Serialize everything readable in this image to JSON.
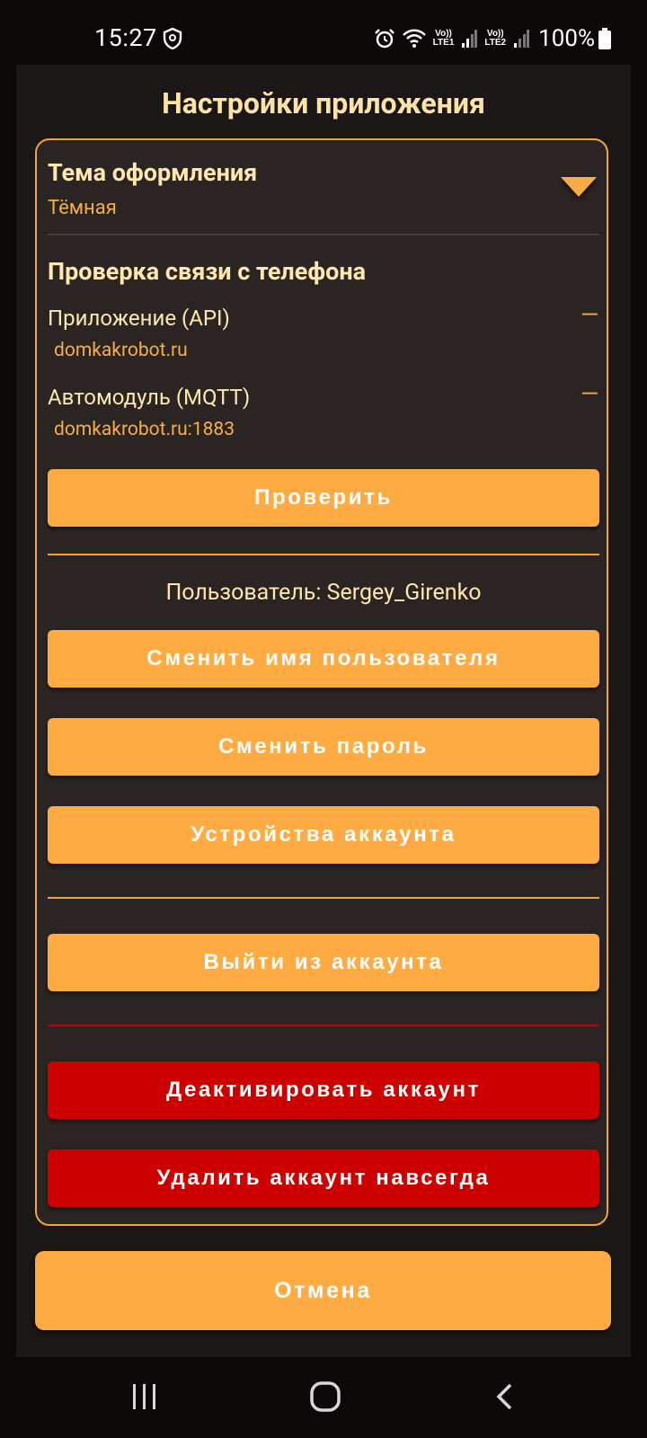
{
  "status_bar": {
    "time": "15:27",
    "sim1_label_top": "Vo))",
    "sim1_label_bottom": "LTE1",
    "sim2_label_top": "Vo))",
    "sim2_label_bottom": "LTE2",
    "battery": "100%",
    "icons": [
      "shield-icon",
      "alarm-icon",
      "wifi-icon",
      "signal-icon",
      "battery-icon"
    ]
  },
  "dialog": {
    "title": "Настройки приложения",
    "theme": {
      "heading": "Тема оформления",
      "selected": "Тёмная"
    },
    "connection": {
      "heading": "Проверка связи с телефона",
      "api_label": "Приложение (API)",
      "api_host": "domkakrobot.ru",
      "api_status": "—",
      "mqtt_label": "Автомодуль (MQTT)",
      "mqtt_host": "domkakrobot.ru:1883",
      "mqtt_status": "—",
      "check_button": "Проверить"
    },
    "user": {
      "label": "Пользователь: Sergey_Girenko",
      "change_name_button": "Сменить имя пользователя",
      "change_password_button": "Сменить пароль",
      "devices_button": "Устройства аккаунта",
      "logout_button": "Выйти из аккаунта",
      "deactivate_button": "Деактивировать аккаунт",
      "delete_button": "Удалить аккаунт навсегда"
    },
    "cancel_button": "Отмена"
  },
  "colors": {
    "accent": "#feab43",
    "danger": "#cc0000",
    "title_text": "#ffe3a6",
    "panel_bg": "#2a2422",
    "dialog_bg": "#1b1716"
  },
  "nav_bar": {
    "icons": [
      "recent-apps-icon",
      "home-icon",
      "back-icon"
    ]
  }
}
